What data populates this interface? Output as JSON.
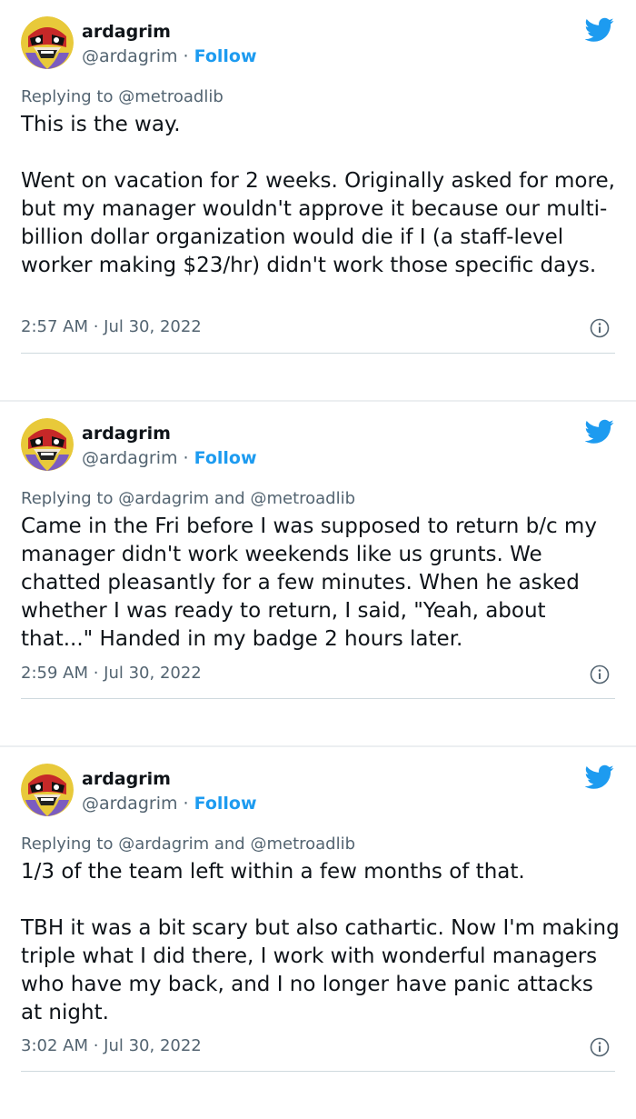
{
  "colors": {
    "accent": "#1d9bf0",
    "secondary_text": "#536471",
    "primary_text": "#0f1419"
  },
  "tweets": [
    {
      "name": "ardagrim",
      "handle": "@ardagrim",
      "follow_label": "Follow",
      "replying_prefix": "Replying to",
      "replying_to": "@metroadlib",
      "paragraphs": [
        "This is the way.",
        "Went on vacation for 2 weeks. Originally asked for more, but my manager wouldn't approve it because our multi-billion dollar organization would die if I (a staff-level worker making $23/hr) didn't work those specific days."
      ],
      "timestamp": "2:57 AM · Jul 30, 2022",
      "icons": [
        "avatar",
        "twitter-bird-icon",
        "info-icon"
      ]
    },
    {
      "name": "ardagrim",
      "handle": "@ardagrim",
      "follow_label": "Follow",
      "replying_prefix": "Replying to",
      "replying_to": "@ardagrim and @metroadlib",
      "paragraphs": [
        "Came in the Fri before I was supposed to return b/c my manager didn't work weekends like us grunts. We chatted pleasantly for a few minutes. When he asked whether I was ready to return, I said, \"Yeah, about that...\" Handed in my badge 2 hours later."
      ],
      "timestamp": "2:59 AM · Jul 30, 2022",
      "icons": [
        "avatar",
        "twitter-bird-icon",
        "info-icon"
      ]
    },
    {
      "name": "ardagrim",
      "handle": "@ardagrim",
      "follow_label": "Follow",
      "replying_prefix": "Replying to",
      "replying_to": "@ardagrim and @metroadlib",
      "paragraphs": [
        "1/3 of the team left within a few months of that.",
        "TBH it was a bit scary but also cathartic. Now I'm making triple what I did there, I work with wonderful managers who have my back, and I no longer have panic attacks at night."
      ],
      "timestamp": "3:02 AM · Jul 30, 2022",
      "icons": [
        "avatar",
        "twitter-bird-icon",
        "info-icon"
      ]
    }
  ]
}
